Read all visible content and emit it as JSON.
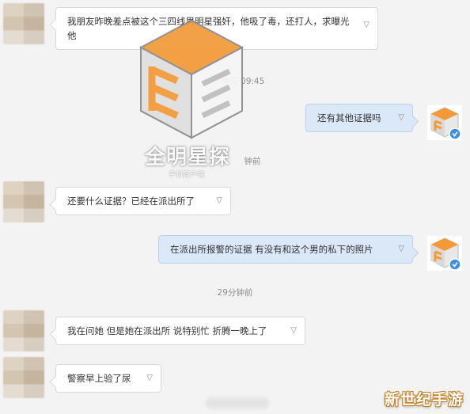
{
  "chat": {
    "messages": [
      {
        "side": "left",
        "text": "我朋友昨晚差点被这个三四线男明星强奸，他吸了毒，还打人，求曝光他"
      },
      {
        "side": "right",
        "text": "还有其他证据吗"
      },
      {
        "side": "left",
        "text": "还要什么证据？已经在派出所了"
      },
      {
        "side": "right",
        "text": "在派出所报警的证据 有没有和这个男的私下的照片"
      },
      {
        "side": "left",
        "text": "我在问她 但是她在派出所 说特别忙 折腾一晚上了"
      },
      {
        "side": "left",
        "text": "警察早上验了尿"
      }
    ],
    "timestamps": {
      "t1": "今天 09:45",
      "t2": "钟前",
      "t3": "29分钟前"
    },
    "expand_icon": "▽"
  },
  "watermark": {
    "name": "全明星探",
    "sub": "手机客户端"
  },
  "corner_logo": "新世纪手游",
  "colors": {
    "accent_orange": "#f39a37",
    "badge_blue": "#3a8ee6",
    "bubble_right": "#dbe8f8"
  }
}
